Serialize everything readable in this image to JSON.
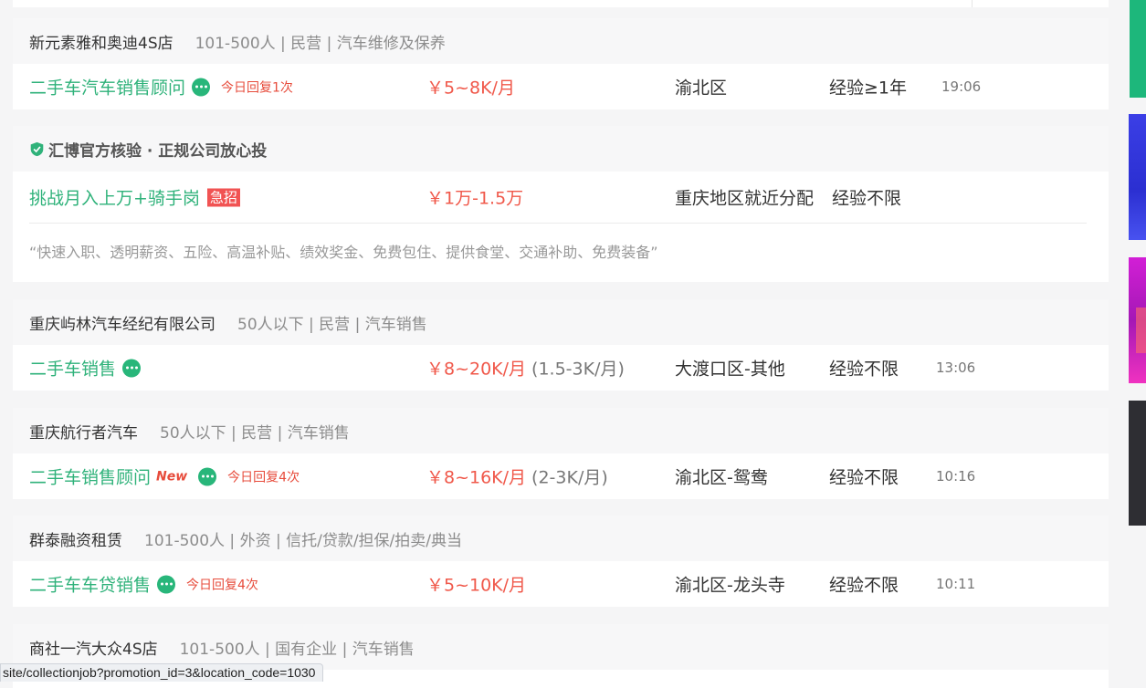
{
  "listings": [
    {
      "company": "新元素雅和奥迪4S店",
      "meta": "101-500人 | 民营 | 汽车维修及保养",
      "title": "二手车汽车销售顾问",
      "reply": "今日回复1次",
      "salary": "￥5~8K/月",
      "salary_alt": "",
      "location": "渝北区",
      "experience": "经验≥1年",
      "time": "19:06"
    },
    {
      "verified": "汇博官方核验 · 正规公司放心投",
      "title": "挑战月入上万+骑手岗",
      "urgent": "急招",
      "salary": "￥1万-1.5万",
      "location": "重庆地区就近分配",
      "experience": "经验不限",
      "description": "“快速入职、透明薪资、五险、高温补贴、绩效奖金、免费包住、提供食堂、交通补助、免费装备”"
    },
    {
      "company": "重庆屿林汽车经纪有限公司",
      "meta": "50人以下 | 民营 | 汽车销售",
      "title": "二手车销售",
      "reply": "",
      "salary": "￥8~20K/月",
      "salary_alt": "(1.5-3K/月)",
      "location": "大渡口区-其他",
      "experience": "经验不限",
      "time": "13:06"
    },
    {
      "company": "重庆航行者汽车",
      "meta": "50人以下 | 民营 | 汽车销售",
      "title": "二手车销售顾问",
      "new_tag": "New",
      "reply": "今日回复4次",
      "salary": "￥8~16K/月",
      "salary_alt": "(2-3K/月)",
      "location": "渝北区-鸳鸯",
      "experience": "经验不限",
      "time": "10:16"
    },
    {
      "company": "群泰融资租赁",
      "meta": "101-500人 | 外资 | 信托/贷款/担保/拍卖/典当",
      "title": "二手车车贷销售",
      "reply": "今日回复4次",
      "salary": "￥5~10K/月",
      "salary_alt": "",
      "location": "渝北区-龙头寺",
      "experience": "经验不限",
      "time": "10:11"
    },
    {
      "company": "商社一汽大众4S店",
      "meta": "101-500人 | 国有企业 | 汽车销售"
    }
  ],
  "status_url": "site/collectionjob?promotion_id=3&location_code=1030",
  "colors": {
    "accent_green": "#2fb27a",
    "salary_red": "#f0584a",
    "urgent_red": "#f15353"
  },
  "icons": [
    "chat-icon",
    "shield-check-icon"
  ]
}
